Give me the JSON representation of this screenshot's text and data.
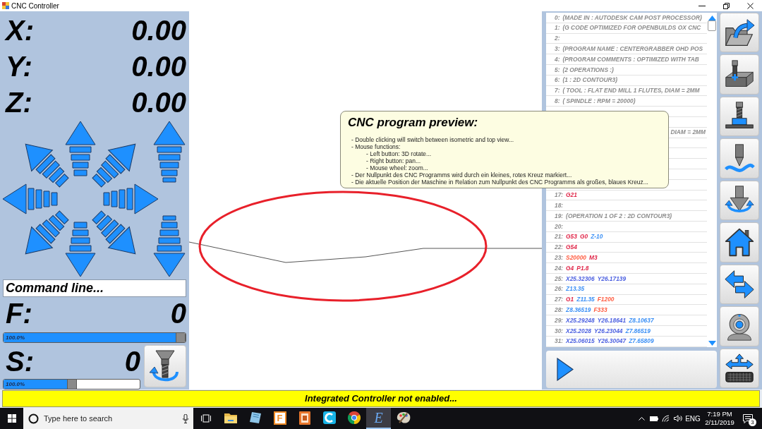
{
  "window": {
    "title": "CNC Controller"
  },
  "axes": [
    {
      "label": "X:",
      "value": "0.00"
    },
    {
      "label": "Y:",
      "value": "0.00"
    },
    {
      "label": "Z:",
      "value": "0.00"
    }
  ],
  "command_line": {
    "placeholder": "Command line..."
  },
  "feed": {
    "label": "F:",
    "value": "0",
    "override": {
      "level": 1.0,
      "reading": "100.0%"
    }
  },
  "spindle": {
    "label": "S:",
    "value": "0",
    "override": {
      "level": 0.5,
      "reading": "100.0%"
    }
  },
  "preview_tooltip": {
    "title": "CNC program preview:",
    "lines": [
      {
        "text": "- Double clicking will switch between isometric and top view..."
      },
      {
        "text": "- Mouse functions:",
        "children": [
          {
            "text": "- Left button: 3D rotate..."
          },
          {
            "text": "- Right button: pan..."
          },
          {
            "text": "- Mouse wheel: zoom..."
          }
        ]
      },
      {
        "text": "- Der Nullpunkt des CNC Programms wird durch ein kleines, rotes Kreuz markiert..."
      },
      {
        "text": "- Die aktuelle Position der Maschine in Relation zum Nullpunkt des CNC Programms als großes, blaues Kreuz..."
      }
    ]
  },
  "program_listing": {
    "rows_top": [
      {
        "number": "0:",
        "tokens": [
          {
            "text": "(MADE IN : AUTODESK CAM POST PROCESSOR)",
            "color": "#8c8c8c"
          }
        ]
      },
      {
        "number": "1:",
        "tokens": [
          {
            "text": "(G CODE OPTIMIZED FOR OPENBUILDS OX CNC",
            "color": "#8c8c8c"
          }
        ]
      },
      {
        "number": "2:"
      },
      {
        "number": "3:",
        "tokens": [
          {
            "text": "(PROGRAM NAME : CENTERGRABBER OHD POS",
            "color": "#8c8c8c"
          }
        ]
      },
      {
        "number": "4:",
        "tokens": [
          {
            "text": "(PROGRAM COMMENTS : OPTIMIZED WITH TAB",
            "color": "#8c8c8c"
          }
        ]
      },
      {
        "number": "5:",
        "tokens": [
          {
            "text": "(2 OPERATIONS :)",
            "color": "#8c8c8c"
          }
        ]
      },
      {
        "number": "6:",
        "tokens": [
          {
            "text": "(1 : 2D CONTOUR3)",
            "color": "#8c8c8c"
          }
        ]
      },
      {
        "number": "7:",
        "tokens": [
          {
            "text": "( TOOL : FLAT END MILL 1 FLUTES, DIAM = 2MM",
            "color": "#8c8c8c"
          }
        ]
      },
      {
        "number": "8:",
        "tokens": [
          {
            "text": "( SPINDLE : RPM = 20000)",
            "color": "#8c8c8c"
          }
        ]
      }
    ],
    "covered_fragment": {
      "text": "DIAM = 2MM",
      "color": "#8c8c8c"
    },
    "rows_bottom": [
      {
        "number": "17:",
        "tokens": [
          {
            "text": "G21",
            "color": "#e0284a"
          }
        ]
      },
      {
        "number": "18:"
      },
      {
        "number": "19:",
        "tokens": [
          {
            "text": "(OPERATION 1 OF 2 : 2D CONTOUR3)",
            "color": "#8c8c8c"
          }
        ]
      },
      {
        "number": "20:"
      },
      {
        "number": "21:",
        "tokens": [
          {
            "text": "G53",
            "color": "#e0284a"
          },
          {
            "text": "G0",
            "color": "#e0284a"
          },
          {
            "text": "Z-10",
            "color": "#3a8ff5"
          }
        ]
      },
      {
        "number": "22:",
        "tokens": [
          {
            "text": "G54",
            "color": "#e0284a"
          }
        ]
      },
      {
        "number": "23:",
        "tokens": [
          {
            "text": "S20000",
            "color": "#ff5c40"
          },
          {
            "text": "M3",
            "color": "#e0284a"
          }
        ]
      },
      {
        "number": "24:",
        "tokens": [
          {
            "text": "G4",
            "color": "#e0284a"
          },
          {
            "text": "P1.8",
            "color": "#e0284a"
          }
        ]
      },
      {
        "number": "25:",
        "tokens": [
          {
            "text": "X25.32306",
            "color": "#4b5fe0"
          },
          {
            "text": "Y26.17139",
            "color": "#4b5fe0"
          }
        ]
      },
      {
        "number": "26:",
        "tokens": [
          {
            "text": "Z13.35",
            "color": "#3a8ff5"
          }
        ]
      },
      {
        "number": "27:",
        "tokens": [
          {
            "text": "G1",
            "color": "#e0284a"
          },
          {
            "text": "Z11.35",
            "color": "#3a8ff5"
          },
          {
            "text": "F1200",
            "color": "#ff5c40"
          }
        ]
      },
      {
        "number": "28:",
        "tokens": [
          {
            "text": "Z8.36519",
            "color": "#3a8ff5"
          },
          {
            "text": "F333",
            "color": "#ff5c40"
          }
        ]
      },
      {
        "number": "29:",
        "tokens": [
          {
            "text": "X25.29248",
            "color": "#4b5fe0"
          },
          {
            "text": "Y26.18641",
            "color": "#4b5fe0"
          },
          {
            "text": "Z8.10637",
            "color": "#3a8ff5"
          }
        ]
      },
      {
        "number": "30:",
        "tokens": [
          {
            "text": "X25.2028",
            "color": "#4b5fe0"
          },
          {
            "text": "Y26.23044",
            "color": "#4b5fe0"
          },
          {
            "text": "Z7.86519",
            "color": "#3a8ff5"
          }
        ]
      },
      {
        "number": "31:",
        "tokens": [
          {
            "text": "X25.06015",
            "color": "#4b5fe0"
          },
          {
            "text": "Y26.30047",
            "color": "#4b5fe0"
          },
          {
            "text": "Z7.65809",
            "color": "#3a8ff5"
          }
        ]
      }
    ]
  },
  "status_bar": {
    "text": "Integrated Controller not enabled..."
  },
  "taskbar": {
    "search": {
      "placeholder": "Type here to search"
    },
    "apps": [
      {
        "kind": "folder",
        "selected": false
      },
      {
        "kind": "notebook",
        "selected": false
      },
      {
        "kind": "letter-tile",
        "glyph": "F",
        "selected": false
      },
      {
        "kind": "document",
        "selected": false
      },
      {
        "kind": "ring-tile",
        "selected": false
      },
      {
        "kind": "browser",
        "selected": false
      },
      {
        "kind": "letter",
        "glyph": "E",
        "selected": true
      },
      {
        "kind": "palette",
        "selected": false
      }
    ],
    "tray": {
      "language": "ENG",
      "time": "7:19 PM",
      "date": "2/11/2019",
      "notifications": "3"
    }
  }
}
